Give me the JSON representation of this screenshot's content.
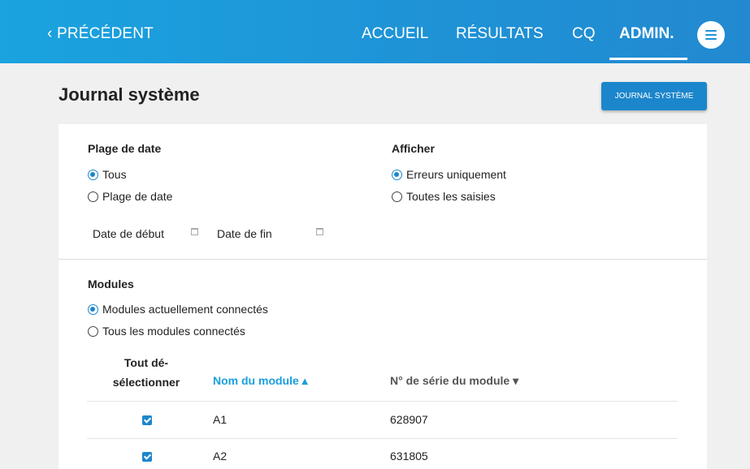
{
  "header": {
    "back_label": "‹ PRÉCÉDENT",
    "nav": [
      "ACCUEIL",
      "RÉSULTATS",
      "CQ",
      "ADMIN."
    ],
    "active_nav": "ADMIN.",
    "menu_icon": "hamburger-icon"
  },
  "page": {
    "title": "Journal système",
    "action_button": "JOURNAL SYSTÈME"
  },
  "date_range": {
    "label": "Plage de date",
    "options": [
      "Tous",
      "Plage de date"
    ],
    "selected": "Tous",
    "start_label": "Date de début",
    "end_label": "Date de fin",
    "start_value": "",
    "end_value": "",
    "picker_icon": "calendar-icon"
  },
  "display": {
    "label": "Afficher",
    "options": [
      "Erreurs uniquement",
      "Toutes les saisies"
    ],
    "selected": "Erreurs uniquement"
  },
  "modules": {
    "label": "Modules",
    "options": [
      "Modules actuellement connectés",
      "Tous les modules connectés"
    ],
    "selected": "Modules actuellement connectés",
    "table": {
      "headers": {
        "select_line1": "Tout dé-",
        "select_line2": "sélectionner",
        "name": "Nom du module ▴",
        "serial": "N° de série du module ▾"
      },
      "sorted_column": "name",
      "rows": [
        {
          "checked": true,
          "name": "A1",
          "serial": "628907"
        },
        {
          "checked": true,
          "name": "A2",
          "serial": "631805"
        }
      ]
    }
  },
  "colors": {
    "header_gradient_start": "#1aa3df",
    "header_gradient_end": "#2289d0",
    "accent": "#1c86cc",
    "sort_active": "#1a9fdc"
  }
}
